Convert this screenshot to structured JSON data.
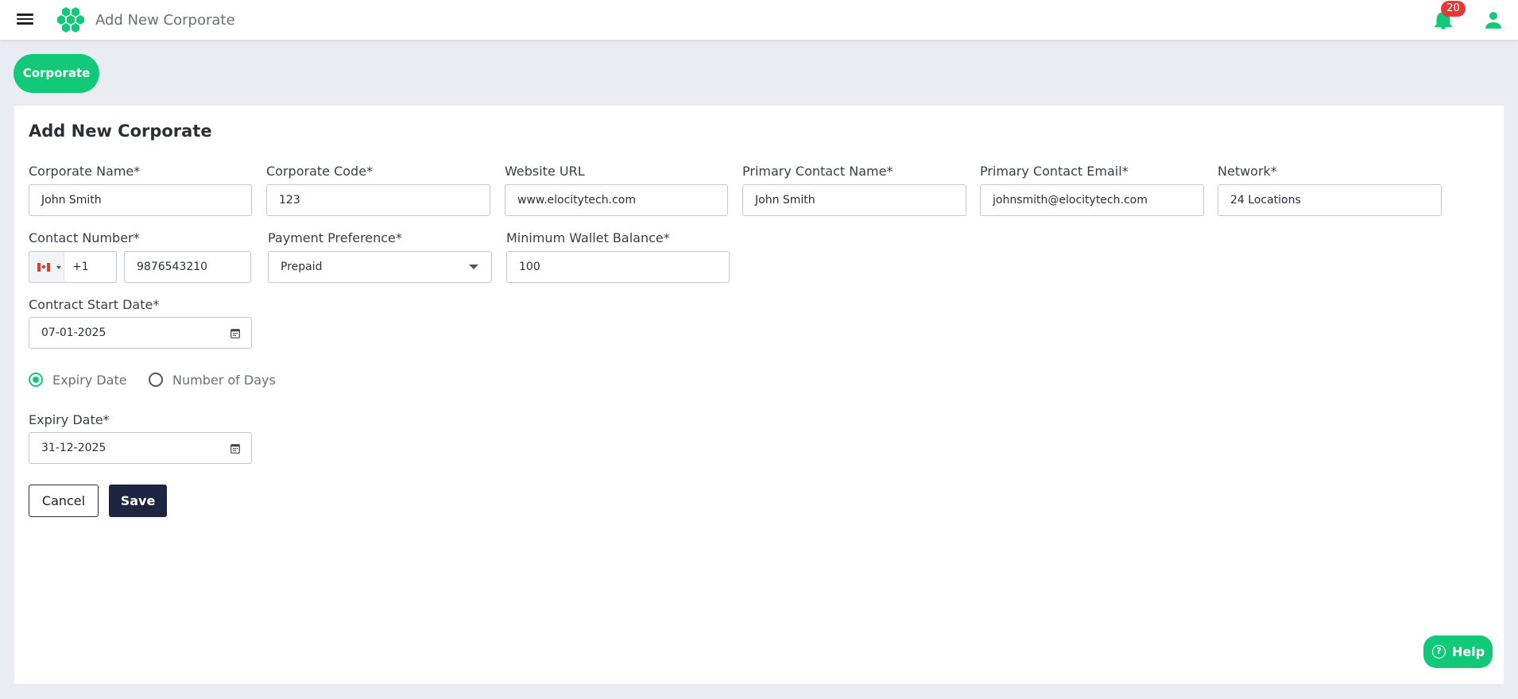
{
  "app": {
    "title": "Add New Corporate",
    "accent_color": "#12c879",
    "notification_count": "20"
  },
  "tab": {
    "label": "Corporate"
  },
  "form": {
    "heading": "Add New Corporate",
    "corporate_name": {
      "label": "Corporate Name*",
      "value": "John Smith"
    },
    "corporate_code": {
      "label": "Corporate Code*",
      "value": "123"
    },
    "website_url": {
      "label": "Website URL",
      "value": "www.elocitytech.com"
    },
    "primary_contact_name": {
      "label": "Primary Contact Name*",
      "value": "John Smith"
    },
    "primary_contact_email": {
      "label": "Primary Contact Email*",
      "value": "johnsmith@elocitytech.com"
    },
    "network": {
      "label": "Network*",
      "value": "24 Locations"
    },
    "contact_number": {
      "label": "Contact Number*",
      "country_flag": "canada-flag-icon",
      "dial_code": "+1",
      "value": "9876543210"
    },
    "payment_preference": {
      "label": "Payment Preference*",
      "value": "Prepaid"
    },
    "minimum_wallet_balance": {
      "label": "Minimum Wallet Balance*",
      "value": "100"
    },
    "contract_start_date": {
      "label": "Contract Start Date*",
      "value": "07-01-2025"
    },
    "expiry_mode": {
      "options": [
        "Expiry Date",
        "Number of Days"
      ],
      "selected": "Expiry Date"
    },
    "expiry_date": {
      "label": "Expiry Date*",
      "value": "31-12-2025"
    },
    "cancel_label": "Cancel",
    "save_label": "Save"
  },
  "help": {
    "label": "Help",
    "icon": "question-circle-icon"
  }
}
